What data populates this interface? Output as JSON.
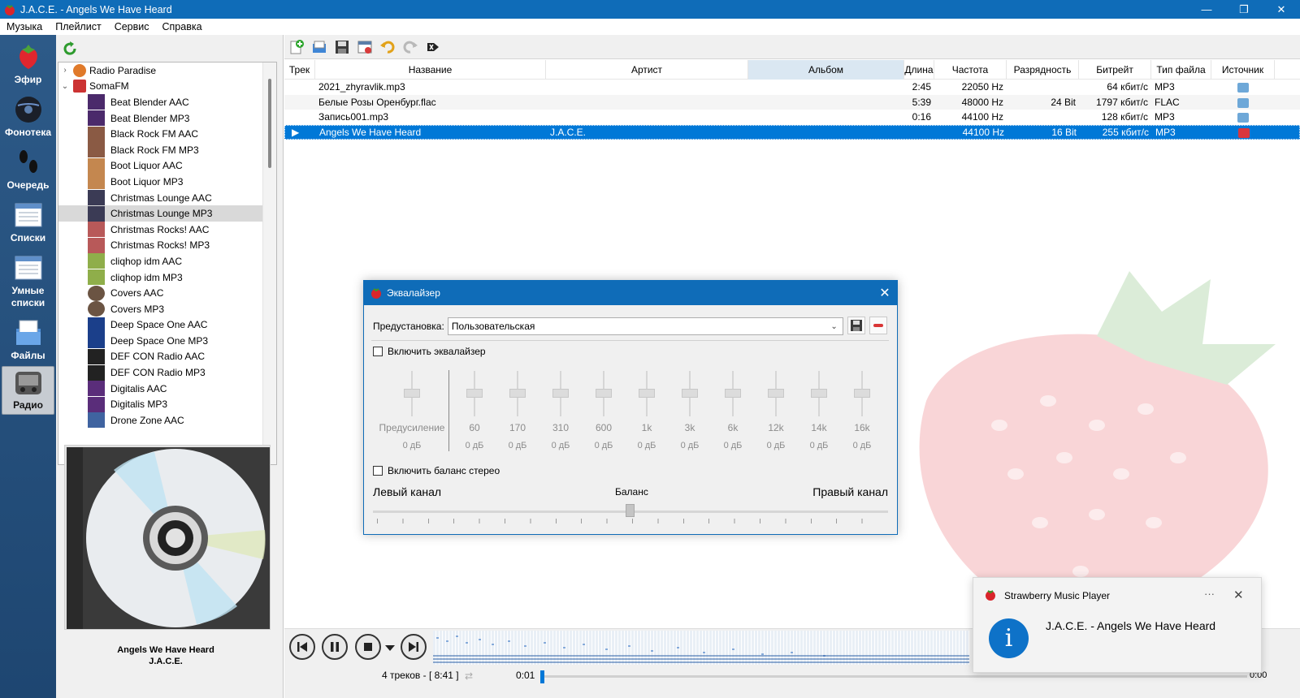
{
  "window": {
    "title": "J.A.C.E. - Angels We Have Heard",
    "controls": [
      "—",
      "❐",
      "✕"
    ]
  },
  "menu": [
    "Музыка",
    "Плейлист",
    "Сервис",
    "Справка"
  ],
  "nav": [
    {
      "label": "Эфир",
      "icon": "strawberry-icon"
    },
    {
      "label": "Фонотека",
      "icon": "library-disc-icon"
    },
    {
      "label": "Очередь",
      "icon": "footsteps-icon"
    },
    {
      "label": "Списки",
      "icon": "playlist-icon"
    },
    {
      "label": "Умные списки",
      "icon": "smart-playlist-icon"
    },
    {
      "label": "Файлы",
      "icon": "files-icon"
    },
    {
      "label": "Радио",
      "icon": "radio-icon"
    }
  ],
  "tree": {
    "roots": [
      "Radio Paradise",
      "SomaFM"
    ],
    "children": [
      "Beat Blender AAC",
      "Beat Blender MP3",
      "Black Rock FM AAC",
      "Black Rock FM MP3",
      "Boot Liquor AAC",
      "Boot Liquor MP3",
      "Christmas Lounge AAC",
      "Christmas Lounge MP3",
      "Christmas Rocks! AAC",
      "Christmas Rocks! MP3",
      "cliqhop idm AAC",
      "cliqhop idm MP3",
      "Covers AAC",
      "Covers MP3",
      "Deep Space One AAC",
      "Deep Space One MP3",
      "DEF CON Radio AAC",
      "DEF CON Radio MP3",
      "Digitalis AAC",
      "Digitalis MP3",
      "Drone Zone AAC"
    ],
    "selected_index": 7
  },
  "now_playing": {
    "title": "Angels We Have Heard",
    "artist": "J.A.C.E."
  },
  "playlist": {
    "headers": [
      "Трек",
      "Название",
      "Артист",
      "Альбом",
      "Длина",
      "Частота",
      "Разрядность",
      "Битрейт",
      "Тип файла",
      "Источник"
    ],
    "rows": [
      {
        "track": "",
        "title": "2021_zhyravlik.mp3",
        "artist": "",
        "album": "",
        "length": "2:45",
        "freq": "22050 Hz",
        "bits": "",
        "bitrate": "64 кбит/с",
        "type": "MP3"
      },
      {
        "track": "",
        "title": "Белые Розы Оренбург.flac",
        "artist": "",
        "album": "",
        "length": "5:39",
        "freq": "48000 Hz",
        "bits": "24 Bit",
        "bitrate": "1797 кбит/с",
        "type": "FLAC"
      },
      {
        "track": "",
        "title": "Запись001.mp3",
        "artist": "",
        "album": "",
        "length": "0:16",
        "freq": "44100 Hz",
        "bits": "",
        "bitrate": "128 кбит/с",
        "type": "MP3"
      },
      {
        "track": "▶",
        "title": "Angels We Have Heard",
        "artist": "J.A.C.E.",
        "album": "",
        "length": "",
        "freq": "44100 Hz",
        "bits": "16 Bit",
        "bitrate": "255 кбит/с",
        "type": "MP3"
      }
    ]
  },
  "status": {
    "summary": "4 треков - [ 8:41 ]",
    "position": "0:01",
    "end": "0:00"
  },
  "equalizer": {
    "title": "Эквалайзер",
    "preset_label": "Предустановка:",
    "preset_value": "Пользовательская",
    "enable_label": "Включить эквалайзер",
    "preamp_label": "Предусиление",
    "bands": [
      "60",
      "170",
      "310",
      "600",
      "1k",
      "3k",
      "6k",
      "12k",
      "14k",
      "16k"
    ],
    "gain": "0 дБ",
    "balance_enable_label": "Включить баланс стерео",
    "left_label": "Левый канал",
    "balance_label": "Баланс",
    "right_label": "Правый канал"
  },
  "toast": {
    "app": "Strawberry Music Player",
    "message": "J.A.C.E. - Angels We Have Heard",
    "more": "···",
    "close": "✕",
    "info": "i"
  }
}
